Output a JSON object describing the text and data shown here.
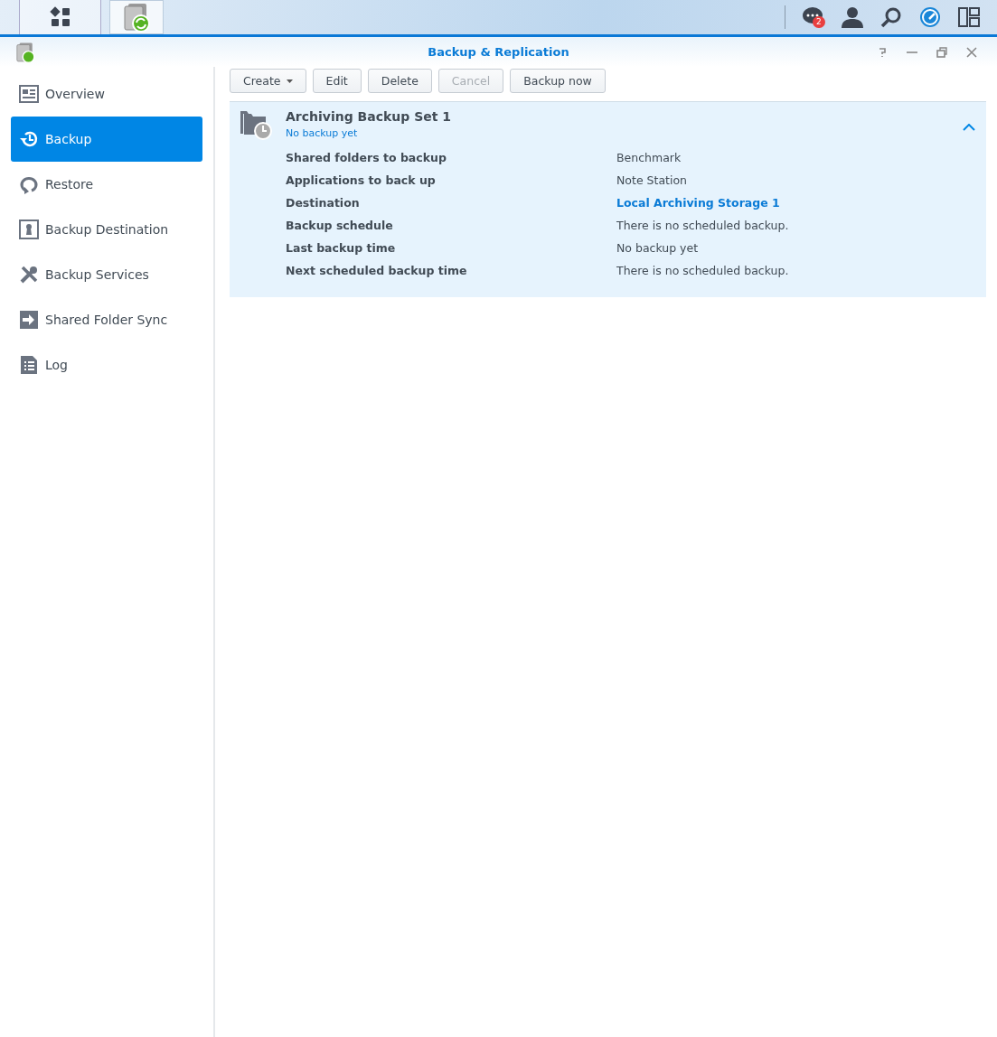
{
  "taskbar": {
    "notification_count": "2"
  },
  "window": {
    "title": "Backup & Replication"
  },
  "sidebar": {
    "items": [
      {
        "label": "Overview",
        "selected": false
      },
      {
        "label": "Backup",
        "selected": true
      },
      {
        "label": "Restore",
        "selected": false
      },
      {
        "label": "Backup Destination",
        "selected": false
      },
      {
        "label": "Backup Services",
        "selected": false
      },
      {
        "label": "Shared Folder Sync",
        "selected": false
      },
      {
        "label": "Log",
        "selected": false
      }
    ]
  },
  "toolbar": [
    {
      "label": "Create",
      "dropdown": true,
      "disabled": false
    },
    {
      "label": "Edit",
      "dropdown": false,
      "disabled": false
    },
    {
      "label": "Delete",
      "dropdown": false,
      "disabled": false
    },
    {
      "label": "Cancel",
      "dropdown": false,
      "disabled": true
    },
    {
      "label": "Backup now",
      "dropdown": false,
      "disabled": false
    }
  ],
  "task": {
    "title": "Archiving Backup Set 1",
    "status": "No backup yet",
    "expanded": true,
    "details": [
      {
        "label": "Shared folders to backup",
        "value": "Benchmark",
        "kind": "text"
      },
      {
        "label": "Applications to back up",
        "value": "Note Station",
        "kind": "text"
      },
      {
        "label": "Destination",
        "value": "Local Archiving Storage 1",
        "kind": "link"
      },
      {
        "label": "Backup schedule",
        "value": "There is no scheduled backup.",
        "kind": "text"
      },
      {
        "label": "Last backup time",
        "value": "No backup yet",
        "kind": "text"
      },
      {
        "label": "Next scheduled backup time",
        "value": "There is no scheduled backup.",
        "kind": "text"
      }
    ]
  }
}
